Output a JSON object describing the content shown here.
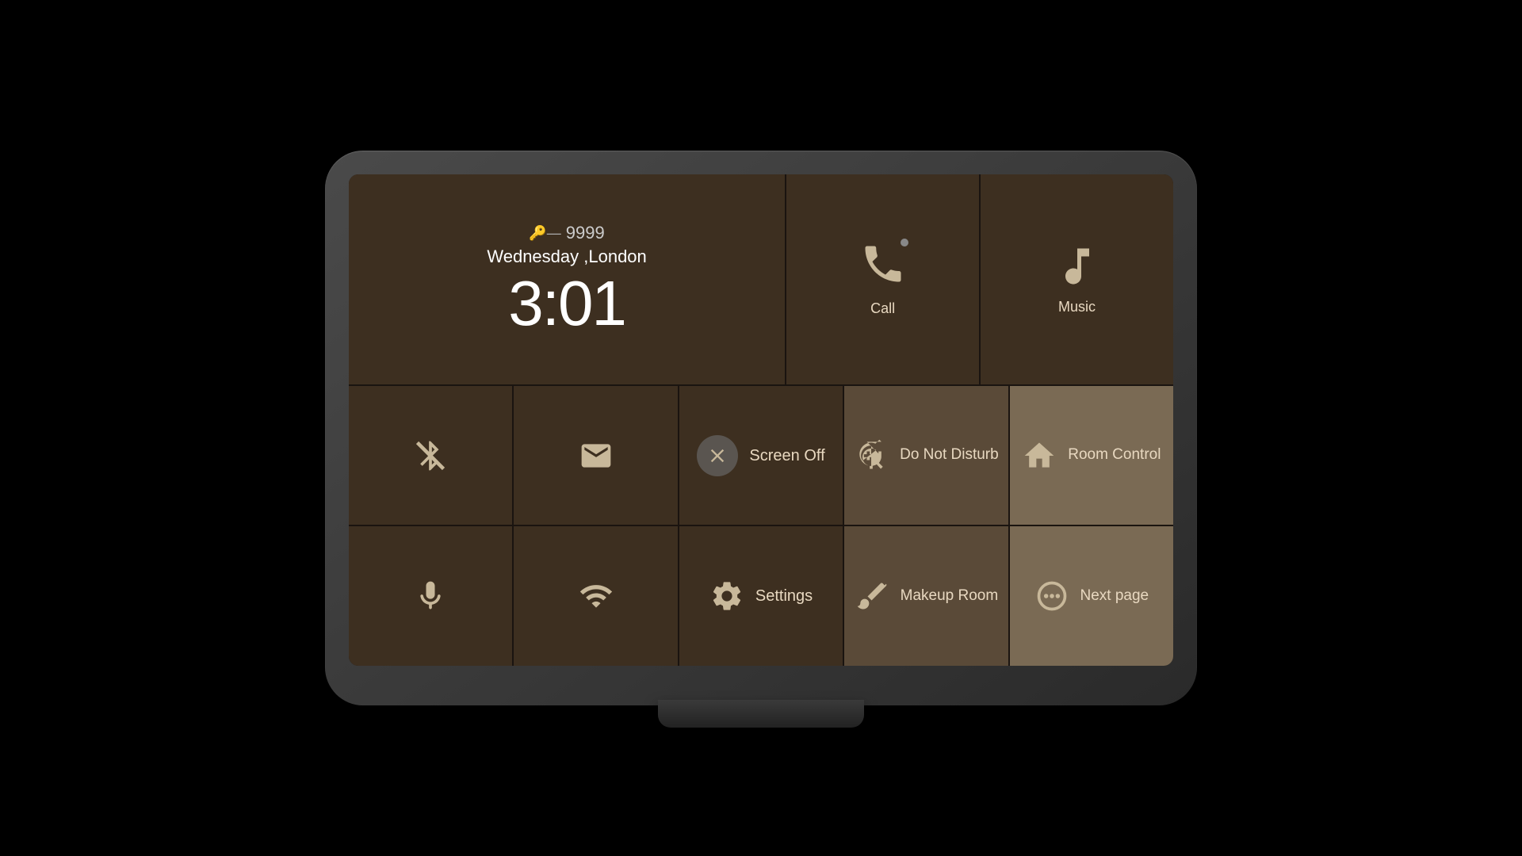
{
  "device": {
    "screen": {
      "top": {
        "clock": {
          "key_symbol": "🔑",
          "room_number": "9999",
          "date": "Wednesday ,London",
          "time": "3:01"
        },
        "call": {
          "label": "Call"
        },
        "music": {
          "label": "Music"
        }
      },
      "row2": [
        {
          "id": "bluetooth",
          "label": "",
          "icon": "bluetooth"
        },
        {
          "id": "message",
          "label": "",
          "icon": "message"
        },
        {
          "id": "screen-off",
          "label": "Screen Off",
          "icon": "close-circle"
        },
        {
          "id": "do-not-disturb",
          "label": "Do Not Disturb",
          "icon": "hand"
        },
        {
          "id": "room-control",
          "label": "Room Control",
          "icon": "home"
        }
      ],
      "row3": [
        {
          "id": "microphone",
          "label": "",
          "icon": "mic"
        },
        {
          "id": "wifi",
          "label": "",
          "icon": "wifi"
        },
        {
          "id": "settings",
          "label": "Settings",
          "icon": "gear"
        },
        {
          "id": "makeup-room",
          "label": "Makeup Room",
          "icon": "brush"
        },
        {
          "id": "next-page",
          "label": "Next page",
          "icon": "dots"
        }
      ]
    }
  },
  "colors": {
    "dark_tile": "#3d2f20",
    "medium_tile": "#5a4a38",
    "light_tile": "#7a6a54",
    "icon_color": "#c8b89a",
    "text_color": "#e8d8c0"
  }
}
